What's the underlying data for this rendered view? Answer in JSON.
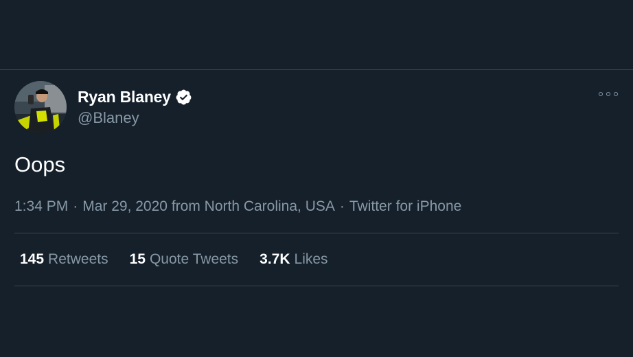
{
  "tweet": {
    "author": {
      "display_name": "Ryan Blaney",
      "handle": "@Blaney",
      "verified": true,
      "avatar_icon": "profile-photo-racer"
    },
    "text": "Oops",
    "meta": {
      "time": "1:34 PM",
      "date": "Mar 29, 2020",
      "location": "from North Carolina, USA",
      "separator": "·",
      "source": "Twitter for iPhone"
    },
    "stats": [
      {
        "count": "145",
        "label": "Retweets"
      },
      {
        "count": "15",
        "label": "Quote Tweets"
      },
      {
        "count": "3.7K",
        "label": "Likes"
      }
    ],
    "more_icon": "more-options-icon"
  },
  "colors": {
    "background": "#15202b",
    "divider": "#38444d",
    "secondary_text": "#8899a6",
    "primary_text": "#ffffff",
    "verified_badge": "#ffffff"
  }
}
